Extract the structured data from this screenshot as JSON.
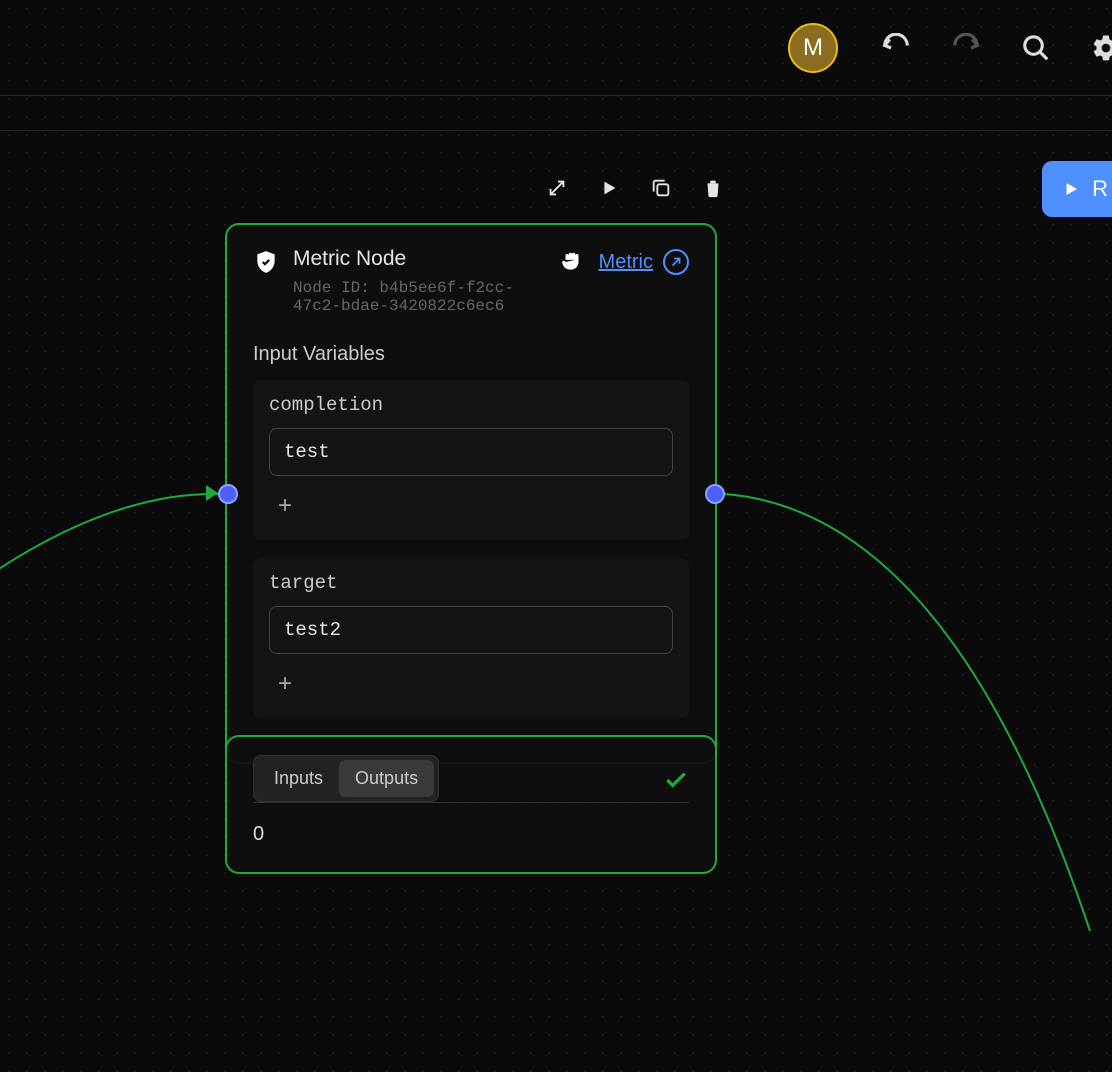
{
  "header": {
    "avatar_initial": "M"
  },
  "canvas": {
    "run_label": "R"
  },
  "node": {
    "title": "Metric Node",
    "id_prefix": "Node ID: ",
    "id": "b4b5ee6f-f2cc-47c2-bdae-3420822c6ec6",
    "link_label": "Metric",
    "section_label": "Input Variables",
    "vars": [
      {
        "name": "completion",
        "value": "test"
      },
      {
        "name": "target",
        "value": "test2"
      }
    ]
  },
  "result": {
    "tabs": [
      "Inputs",
      "Outputs"
    ],
    "active_tab": 1,
    "value": "0"
  }
}
